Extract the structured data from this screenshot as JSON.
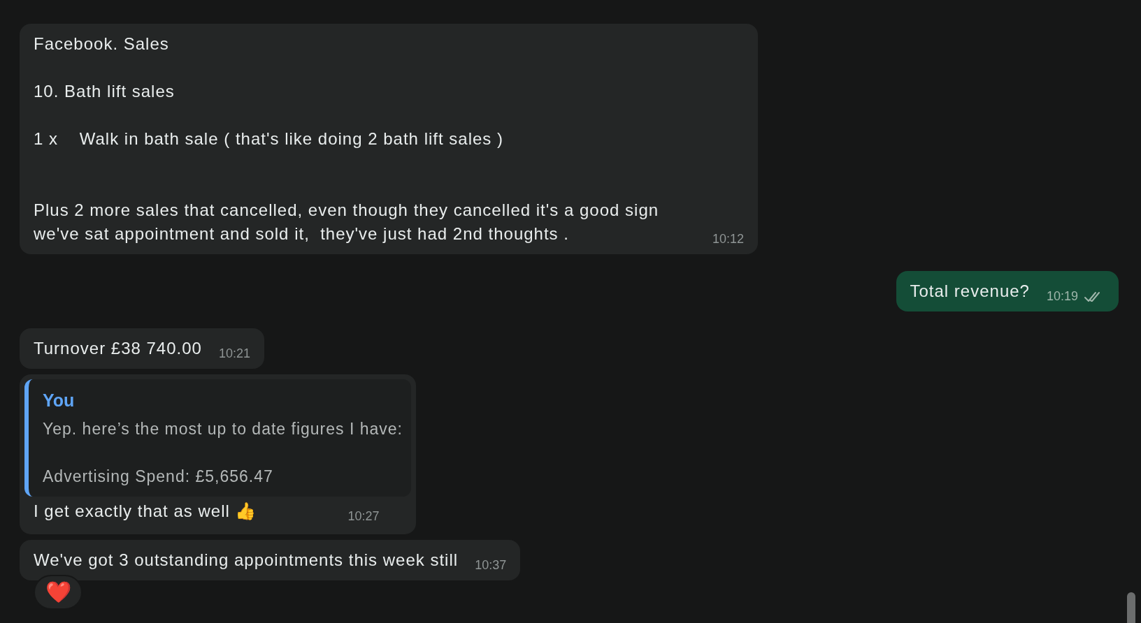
{
  "messages": [
    {
      "kind": "text",
      "outgoing": false,
      "text": "Facebook. Sales\n\n10. Bath lift sales\n\n1 x    Walk in bath sale ( that's like doing 2 bath lift sales )\n\n\nPlus 2 more sales that cancelled, even though they cancelled it's a good sign we've sat appointment and sold it,  they've just had 2nd thoughts .",
      "time": "10:12"
    },
    {
      "kind": "text",
      "outgoing": true,
      "text": "Total revenue?",
      "time": "10:19",
      "read": false
    },
    {
      "kind": "text",
      "outgoing": false,
      "text": "Turnover £38 740.00",
      "time": "10:21"
    },
    {
      "kind": "quoted",
      "outgoing": false,
      "quote": {
        "author": "You",
        "text": "Yep. here’s the most up to date figures I have:\n\nAdvertising Spend: £5,656.47"
      },
      "text": "I get exactly that as well 👍",
      "time": "10:27"
    },
    {
      "kind": "text",
      "outgoing": false,
      "text": "We've got 3 outstanding appointments this week still",
      "time": "10:37",
      "reaction": "❤️"
    }
  ]
}
